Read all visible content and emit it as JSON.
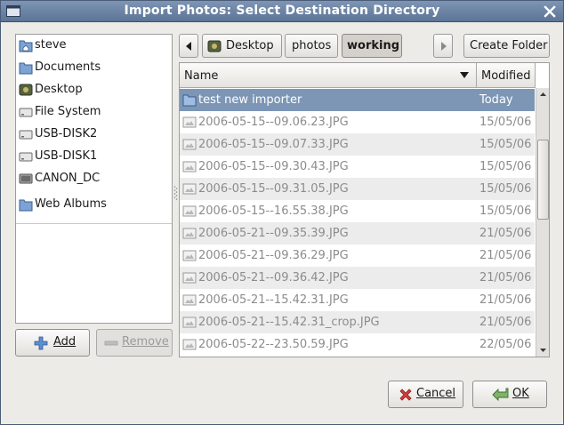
{
  "window": {
    "title": "Import Photos: Select Destination Directory"
  },
  "places": [
    {
      "label": "steve",
      "icon": "home-folder-icon"
    },
    {
      "label": "Documents",
      "icon": "folder-icon"
    },
    {
      "label": "Desktop",
      "icon": "desktop-icon"
    },
    {
      "label": "File System",
      "icon": "drive-icon"
    },
    {
      "label": "USB-DISK2",
      "icon": "drive-icon"
    },
    {
      "label": "USB-DISK1",
      "icon": "drive-icon"
    },
    {
      "label": "CANON_DC",
      "icon": "camera-drive-icon"
    },
    {
      "label": "Web Albums",
      "icon": "folder-icon"
    }
  ],
  "places_buttons": {
    "add": "Add",
    "remove": "Remove"
  },
  "pathbar": {
    "segments": [
      {
        "label": "Desktop"
      },
      {
        "label": "photos"
      },
      {
        "label": "working"
      }
    ],
    "create_folder": "Create Folder"
  },
  "filelist": {
    "columns": {
      "name": "Name",
      "modified": "Modified"
    },
    "rows": [
      {
        "name": "test new importer",
        "modified": "Today",
        "type": "folder"
      },
      {
        "name": "2006-05-15--09.06.23.JPG",
        "modified": "15/05/06",
        "type": "image"
      },
      {
        "name": "2006-05-15--09.07.33.JPG",
        "modified": "15/05/06",
        "type": "image"
      },
      {
        "name": "2006-05-15--09.30.43.JPG",
        "modified": "15/05/06",
        "type": "image"
      },
      {
        "name": "2006-05-15--09.31.05.JPG",
        "modified": "15/05/06",
        "type": "image"
      },
      {
        "name": "2006-05-15--16.55.38.JPG",
        "modified": "15/05/06",
        "type": "image"
      },
      {
        "name": "2006-05-21--09.35.39.JPG",
        "modified": "21/05/06",
        "type": "image"
      },
      {
        "name": "2006-05-21--09.36.29.JPG",
        "modified": "21/05/06",
        "type": "image"
      },
      {
        "name": "2006-05-21--09.36.42.JPG",
        "modified": "21/05/06",
        "type": "image"
      },
      {
        "name": "2006-05-21--15.42.31.JPG",
        "modified": "21/05/06",
        "type": "image"
      },
      {
        "name": "2006-05-21--15.42.31_crop.JPG",
        "modified": "21/05/06",
        "type": "image"
      },
      {
        "name": "2006-05-22--23.50.59.JPG",
        "modified": "22/05/06",
        "type": "image"
      }
    ]
  },
  "dialog_buttons": {
    "cancel": "Cancel",
    "ok": "OK"
  },
  "colors": {
    "titlebar": "#6a82a5",
    "selection": "#7d96b6"
  }
}
